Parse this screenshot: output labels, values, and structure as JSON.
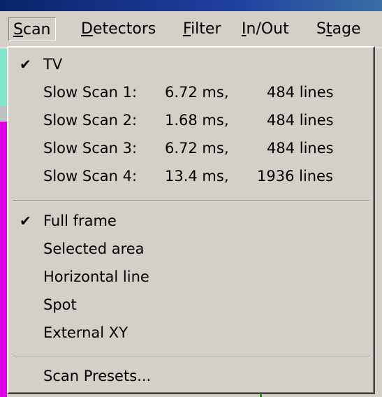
{
  "menubar": {
    "items": [
      {
        "label": "Scan",
        "mnemonic": "S",
        "open": true
      },
      {
        "label": "Detectors",
        "mnemonic": "D"
      },
      {
        "label": "Filter",
        "mnemonic": "F"
      },
      {
        "label": "In/Out",
        "mnemonic": "I"
      },
      {
        "label": "Stage",
        "mnemonic": "t"
      }
    ]
  },
  "scan_menu": {
    "scan_modes": [
      {
        "label": "TV",
        "checked": true
      },
      {
        "label": "Slow Scan 1:",
        "time": "6.72 ms,",
        "lines": "484 lines"
      },
      {
        "label": "Slow Scan 2:",
        "time": "1.68 ms,",
        "lines": "484 lines"
      },
      {
        "label": "Slow Scan 3:",
        "time": "6.72 ms,",
        "lines": "484 lines"
      },
      {
        "label": "Slow Scan 4:",
        "time": "13.4   ms,",
        "lines": "1936 lines"
      }
    ],
    "frame_modes": [
      {
        "label": "Full frame",
        "checked": true
      },
      {
        "label": "Selected area"
      },
      {
        "label": "Horizontal line"
      },
      {
        "label": "Spot"
      },
      {
        "label": "External XY"
      }
    ],
    "presets_label": "Scan Presets...",
    "check_glyph": "✔"
  },
  "colors": {
    "menu_bg": "#d4d0c8",
    "titlebar": "#0a246a",
    "left_strip_top": "#7fe8c8",
    "left_strip_bottom": "#e000e8"
  }
}
